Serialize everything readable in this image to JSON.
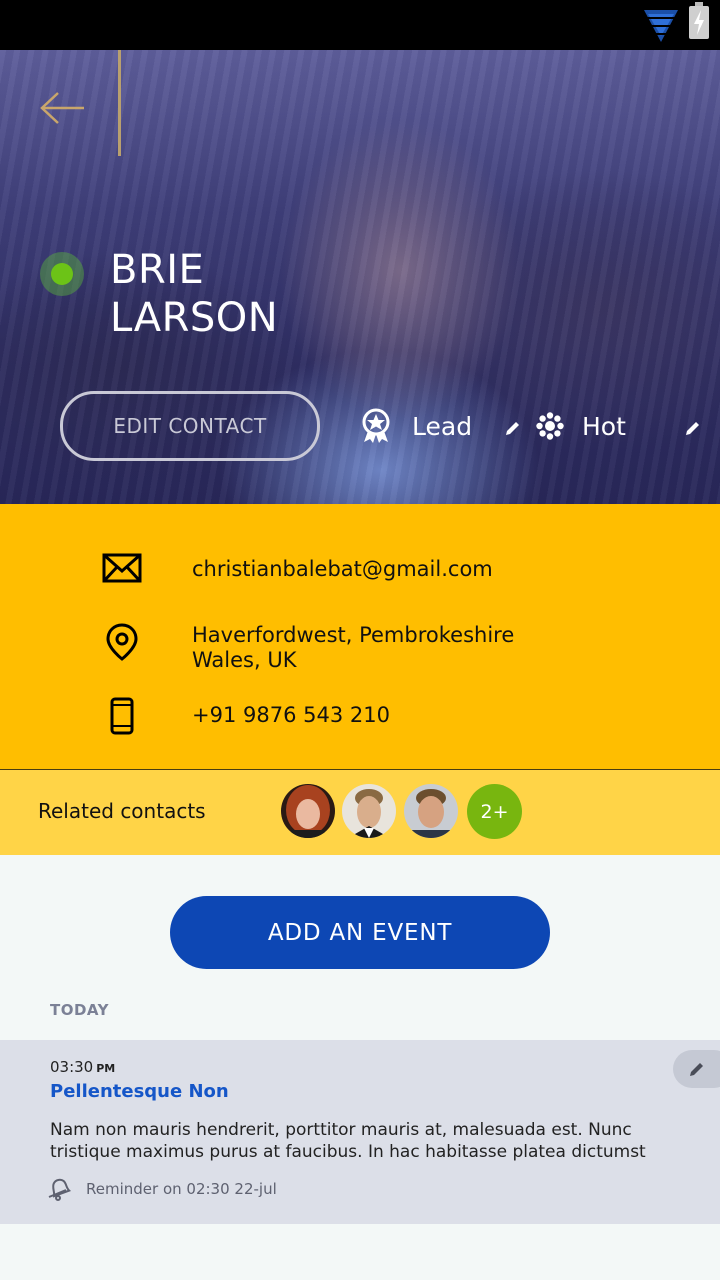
{
  "status_bar": {
    "wifi_icon": "wifi-icon",
    "battery_icon": "battery-charging-icon"
  },
  "profile": {
    "first_name": "BRIE",
    "last_name": "LARSON",
    "online": true,
    "edit_label": "EDIT CONTACT",
    "tags": [
      {
        "label": "Lead",
        "icon": "award-ribbon-icon"
      },
      {
        "label": "Hot",
        "icon": "sun-icon"
      }
    ]
  },
  "contact": {
    "email": "christianbalebat@gmail.com",
    "address_line1": "Haverfordwest, Pembrokeshire",
    "address_line2": "Wales, UK",
    "phone": "+91 9876 543 210"
  },
  "related": {
    "label": "Related contacts",
    "more_count": "2+"
  },
  "actions": {
    "add_event_label": "ADD AN EVENT"
  },
  "events": {
    "section_label": "TODAY",
    "items": [
      {
        "time": "03:30",
        "ampm": "PM",
        "title": "Pellentesque Non",
        "body": "Nam non mauris hendrerit, porttitor mauris at, malesuada est. Nunc tristique maximus purus at faucibus. In hac habitasse platea dictumst",
        "reminder": "Reminder on 02:30 22-jul"
      }
    ]
  },
  "colors": {
    "accent_yellow": "#ffbe00",
    "related_yellow": "#ffd447",
    "primary_blue": "#0d47b4",
    "online_green": "#6cc317",
    "badge_green": "#78b60f"
  }
}
